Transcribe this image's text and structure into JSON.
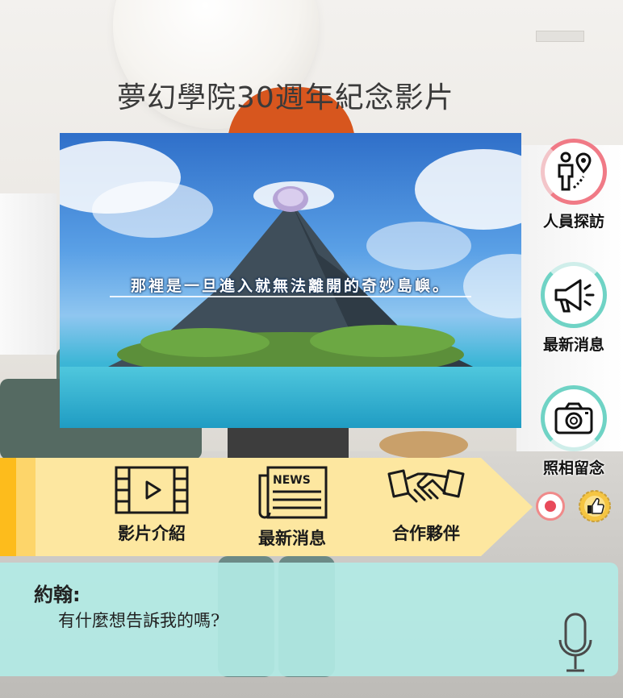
{
  "title": "夢幻學院30週年紀念影片",
  "video": {
    "subtitle": "那裡是一旦進入就無法離開的奇妙島嶼。"
  },
  "side_nav": [
    {
      "label": "人員探訪",
      "icon": "person-location-icon",
      "ring_color": "#f07a86"
    },
    {
      "label": "最新消息",
      "icon": "megaphone-icon",
      "ring_color": "#6fd3c5"
    },
    {
      "label": "照相留念",
      "icon": "camera-icon",
      "ring_color": "#6fd3c5"
    }
  ],
  "banner": {
    "items": [
      {
        "label": "影片介紹",
        "icon": "film-play-icon"
      },
      {
        "label": "最新消息",
        "icon": "news-icon",
        "icon_text": "NEWS"
      },
      {
        "label": "合作夥伴",
        "icon": "handshake-icon"
      }
    ],
    "colors": {
      "bg": "#fde7a0",
      "strip": "#fdbc1c"
    }
  },
  "controls": {
    "record_icon": "record-icon",
    "like_icon": "thumbs-up-icon"
  },
  "dialog": {
    "speaker": "約翰:",
    "message": "有什麼想告訴我的嗎?",
    "mic_icon": "microphone-icon"
  }
}
